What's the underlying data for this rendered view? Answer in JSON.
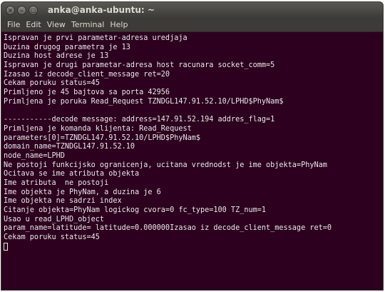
{
  "window": {
    "title": "anka@anka-ubuntu: ~",
    "buttons": {
      "close": "×",
      "minimize": "–",
      "maximize": "□"
    }
  },
  "menubar": {
    "items": [
      "File",
      "Edit",
      "View",
      "Terminal",
      "Help"
    ]
  },
  "terminal": {
    "lines": [
      "Ispravan je prvi parametar-adresa uredjaja",
      "Duzina drugog parametra je 13",
      "Duzina host adrese je 13",
      "Ispravan je drugi parametar-adresa host racunara socket_comm=5",
      "Izasao iz decode_client_message ret=20",
      "Cekam poruku status=45",
      "Primljeno je 45 bajtova sa porta 42956",
      "Primljena je poruka Read_Request TZNDGL147.91.52.10/LPHD$PhyNam$",
      "",
      "-----------decode message: address=147.91.52.194 addres_flag=1",
      "Primljena je komanda klijenta: Read_Request",
      "parameters[0]=TZNDGL147.91.52.10/LPHD$PhyNam$",
      "domain_name=TZNDGL147.91.52.10",
      "node_name=LPHD",
      "Ne postoji funkcijsko ogranicenja, ucitana vrednodst je ime objekta=PhyNam",
      "Ocitava se ime atributa objekta",
      "Ime atributa  ne postoji",
      "Ime objekta je PhyNam, a duzina je 6",
      "Ime objekta ne sadrzi index",
      "Citanje objekta=PhyNam logickog cvora=0 fc_type=100 TZ_num=1",
      "Usao u read_LPHD_object",
      "param_name=latitude= latitude=0.000000Izasao iz decode_client_message ret=0",
      "Cekam poruku status=45"
    ]
  }
}
